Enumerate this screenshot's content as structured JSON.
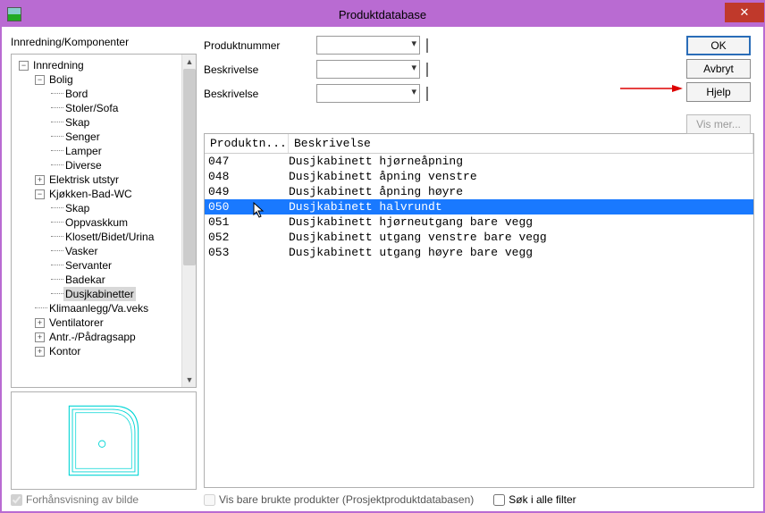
{
  "window": {
    "title": "Produktdatabase"
  },
  "left_label": "Innredning/Komponenter",
  "tree": [
    {
      "level": 0,
      "toggle": "-",
      "label": "Innredning"
    },
    {
      "level": 1,
      "toggle": "-",
      "label": "Bolig"
    },
    {
      "level": 2,
      "toggle": "",
      "label": "Bord"
    },
    {
      "level": 2,
      "toggle": "",
      "label": "Stoler/Sofa"
    },
    {
      "level": 2,
      "toggle": "",
      "label": "Skap"
    },
    {
      "level": 2,
      "toggle": "",
      "label": "Senger"
    },
    {
      "level": 2,
      "toggle": "",
      "label": "Lamper"
    },
    {
      "level": 2,
      "toggle": "",
      "label": "Diverse"
    },
    {
      "level": 1,
      "toggle": "+",
      "label": "Elektrisk utstyr"
    },
    {
      "level": 1,
      "toggle": "-",
      "label": "Kjøkken-Bad-WC"
    },
    {
      "level": 2,
      "toggle": "",
      "label": "Skap"
    },
    {
      "level": 2,
      "toggle": "",
      "label": "Oppvaskkum"
    },
    {
      "level": 2,
      "toggle": "",
      "label": "Klosett/Bidet/Urina"
    },
    {
      "level": 2,
      "toggle": "",
      "label": "Vasker"
    },
    {
      "level": 2,
      "toggle": "",
      "label": "Servanter"
    },
    {
      "level": 2,
      "toggle": "",
      "label": "Badekar"
    },
    {
      "level": 2,
      "toggle": "",
      "label": "Dusjkabinetter",
      "selected": true
    },
    {
      "level": 1,
      "toggle": "",
      "label": "Klimaanlegg/Va.veks"
    },
    {
      "level": 1,
      "toggle": "+",
      "label": "Ventilatorer"
    },
    {
      "level": 1,
      "toggle": "+",
      "label": "Antr.-/Pådragsapp"
    },
    {
      "level": 1,
      "toggle": "+",
      "label": "Kontor"
    }
  ],
  "preview_checkbox": "Forhånsvisning av bilde",
  "form": {
    "row1": "Produktnummer",
    "row2": "Beskrivelse",
    "row3": "Beskrivelse"
  },
  "buttons": {
    "ok": "OK",
    "cancel": "Avbryt",
    "help": "Hjelp",
    "more": "Vis mer..."
  },
  "table": {
    "headers": {
      "num": "Produktn...",
      "desc": "Beskrivelse"
    },
    "rows": [
      {
        "num": "047",
        "desc": "Dusjkabinett hjørneåpning"
      },
      {
        "num": "048",
        "desc": "Dusjkabinett åpning venstre"
      },
      {
        "num": "049",
        "desc": "Dusjkabinett åpning høyre"
      },
      {
        "num": "050",
        "desc": "Dusjkabinett halvrundt",
        "selected": true
      },
      {
        "num": "051",
        "desc": "Dusjkabinett hjørneutgang bare vegg"
      },
      {
        "num": "052",
        "desc": "Dusjkabinett utgang venstre bare vegg"
      },
      {
        "num": "053",
        "desc": "Dusjkabinett utgang høyre bare vegg"
      }
    ]
  },
  "bottom": {
    "used_only": "Vis bare brukte produkter (Prosjektproduktdatabasen)",
    "search_all": "Søk i alle filter"
  }
}
